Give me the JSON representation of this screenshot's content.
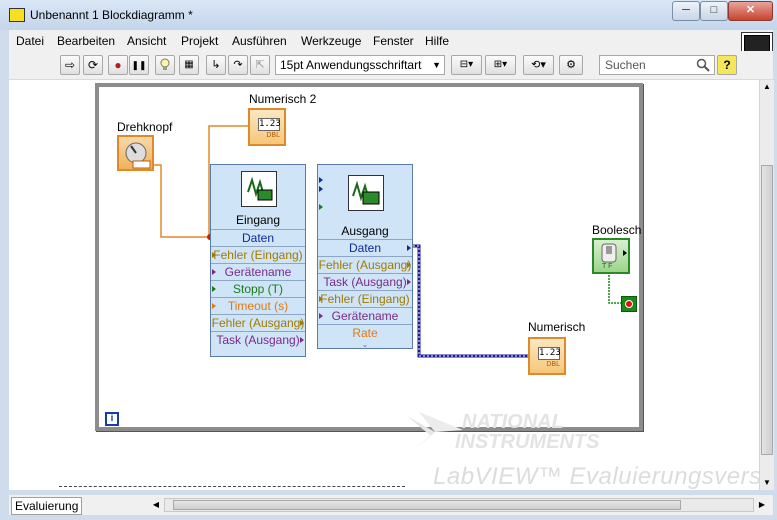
{
  "window": {
    "title": "Unbenannt 1 Blockdiagramm *",
    "minimize": "─",
    "maximize": "□",
    "close": "✕"
  },
  "menu": [
    "Datei",
    "Bearbeiten",
    "Ansicht",
    "Projekt",
    "Ausführen",
    "Werkzeuge",
    "Fenster",
    "Hilfe"
  ],
  "toolbar": {
    "run": "⇨",
    "run_continuous": "⟳",
    "abort": "●",
    "pause": "❚❚",
    "highlight": "💡",
    "font": "15pt Anwendungsschriftart",
    "search_placeholder": "Suchen",
    "help": "?"
  },
  "diagram": {
    "drehknopf_label": "Drehknopf",
    "numerisch2_label": "Numerisch 2",
    "numerisch_label": "Numerisch",
    "boolesch_label": "Boolesch",
    "num_display": "1.23",
    "dbl": "DBL",
    "bool_tf": "T F",
    "eingang": {
      "title": "Eingang",
      "rows": [
        {
          "text": "Daten",
          "color": "#102a9a"
        },
        {
          "text": "Fehler (Eingang)",
          "color": "#a07a00"
        },
        {
          "text": "Gerätename",
          "color": "#7a2a8a"
        },
        {
          "text": "Stopp (T)",
          "color": "#1a7a1a"
        },
        {
          "text": "Timeout (s)",
          "color": "#e07a10"
        },
        {
          "text": "Fehler (Ausgang)",
          "color": "#a07a00"
        },
        {
          "text": "Task (Ausgang)",
          "color": "#7a2a8a"
        }
      ]
    },
    "ausgang": {
      "title": "Ausgang",
      "rows": [
        {
          "text": "Daten",
          "color": "#102a9a"
        },
        {
          "text": "Fehler (Ausgang)",
          "color": "#a07a00"
        },
        {
          "text": "Task (Ausgang)",
          "color": "#7a2a8a"
        },
        {
          "text": "Fehler (Eingang)",
          "color": "#a07a00"
        },
        {
          "text": "Gerätename",
          "color": "#7a2a8a"
        },
        {
          "text": "Rate",
          "color": "#e07a10"
        }
      ]
    },
    "info_icon": "i"
  },
  "watermark": {
    "line1": "NATIONAL",
    "line2": "INSTRUMENTS",
    "line3": "LabVIEW™ Evaluierungsversion"
  },
  "status": {
    "label": "Evaluierung"
  }
}
